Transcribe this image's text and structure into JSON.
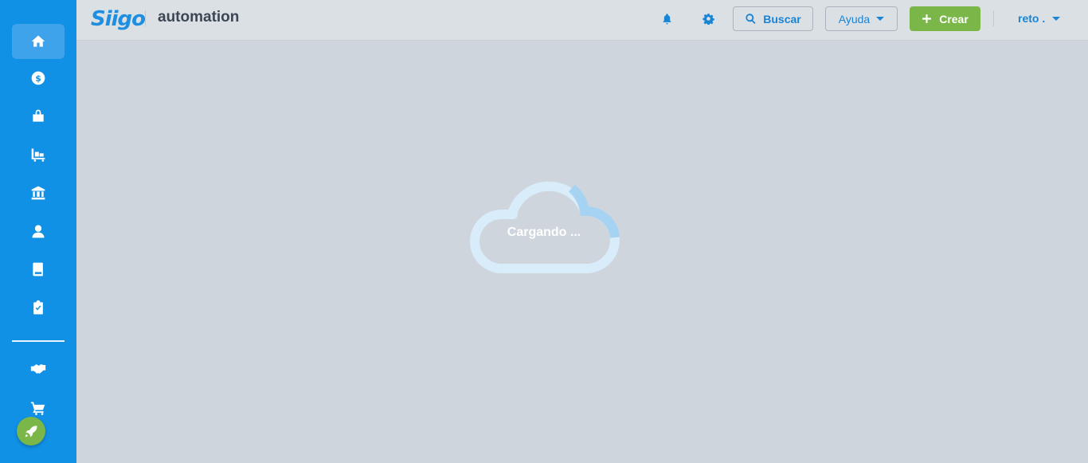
{
  "sidebar": {
    "items": [
      {
        "icon": "home-icon",
        "active": true
      },
      {
        "icon": "dollar-circle-icon"
      },
      {
        "icon": "shopping-bag-icon"
      },
      {
        "icon": "warehouse-cart-icon"
      },
      {
        "icon": "bank-icon"
      },
      {
        "icon": "employee-icon"
      },
      {
        "icon": "book-icon"
      },
      {
        "icon": "clipboard-check-icon"
      },
      {
        "icon": "handshake-icon"
      },
      {
        "icon": "shopping-cart-icon"
      }
    ],
    "rocket_icon": "rocket-icon"
  },
  "header": {
    "logo_text": "Siigo",
    "company": "automation",
    "search_label": "Buscar",
    "help_label": "Ayuda",
    "create_label": "Crear",
    "user_label": "reto ."
  },
  "main": {
    "loading_text": "Cargando ..."
  },
  "colors": {
    "sidebar": "#1191e6",
    "accent": "#1a84d4",
    "create_button": "#7ab648",
    "background": "#ced5dd"
  }
}
